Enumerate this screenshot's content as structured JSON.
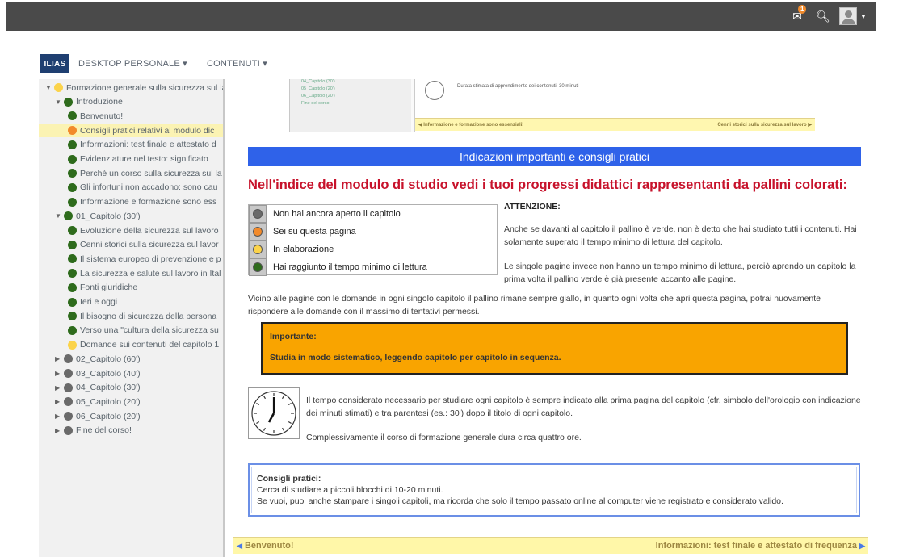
{
  "header": {
    "notification_count": "1"
  },
  "nav": {
    "logo": "ILIAS",
    "desktop": "DESKTOP PERSONALE ▾",
    "contenuti": "CONTENUTI ▾"
  },
  "tree": {
    "items": [
      {
        "label": "Formazione generale sulla sicurezza sul lav",
        "dot": "yellow",
        "arrow": "▼"
      },
      {
        "label": "Introduzione",
        "dot": "green",
        "arrow": "▼"
      },
      {
        "label": "Benvenuto!",
        "dot": "green"
      },
      {
        "label": "Consigli pratici relativi al modulo dic",
        "dot": "orange"
      },
      {
        "label": "Informazioni: test finale e attestato d",
        "dot": "green"
      },
      {
        "label": "Evidenziature nel testo: significato",
        "dot": "green"
      },
      {
        "label": "Perchè un corso sulla sicurezza sul la",
        "dot": "green"
      },
      {
        "label": "Gli infortuni non accadono: sono cau",
        "dot": "green"
      },
      {
        "label": "Informazione e formazione sono ess",
        "dot": "green"
      },
      {
        "label": "01_Capitolo (30')",
        "dot": "green",
        "arrow": "▼"
      },
      {
        "label": "Evoluzione della sicurezza sul lavoro",
        "dot": "green"
      },
      {
        "label": "Cenni storici sulla sicurezza sul lavor",
        "dot": "green"
      },
      {
        "label": "Il sistema europeo di prevenzione e p",
        "dot": "green"
      },
      {
        "label": "La sicurezza e salute sul lavoro in Ital",
        "dot": "green"
      },
      {
        "label": "Fonti giuridiche",
        "dot": "green"
      },
      {
        "label": "Ieri e oggi",
        "dot": "green"
      },
      {
        "label": "Il bisogno di sicurezza della persona",
        "dot": "green"
      },
      {
        "label": "Verso una \"cultura della sicurezza su",
        "dot": "green"
      },
      {
        "label": "Domande sui contenuti del capitolo 1",
        "dot": "yellow"
      },
      {
        "label": "02_Capitolo (60')",
        "dot": "grey",
        "arrow": "▶"
      },
      {
        "label": "03_Capitolo (40')",
        "dot": "grey",
        "arrow": "▶"
      },
      {
        "label": "04_Capitolo (30')",
        "dot": "grey",
        "arrow": "▶"
      },
      {
        "label": "05_Capitolo (20')",
        "dot": "grey",
        "arrow": "▶"
      },
      {
        "label": "06_Capitolo (20')",
        "dot": "grey",
        "arrow": "▶"
      },
      {
        "label": "Fine del corso!",
        "dot": "grey",
        "arrow": "▶"
      }
    ]
  },
  "thumb": {
    "items": [
      "04_Capitolo (30')",
      "05_Capitolo (20')",
      "06_Capitolo (20')",
      "Fine del corso!"
    ],
    "duration": "Durata stimata di apprendimento dei contenuti: 30 minuti",
    "prev": "◀ Informazione e formazione sono essenziali!",
    "next": "Cenni storici sulla sicurezza sul lavoro ▶"
  },
  "content": {
    "section_title": "Indicazioni importanti e consigli pratici",
    "red_title": "Nell'indice del modulo di studio vedi i tuoi progressi didattici rappresentanti da pallini colorati:",
    "legend": [
      {
        "label": "Non hai ancora aperto il capitolo",
        "color": "#6a6a6a"
      },
      {
        "label": "Sei su questa pagina",
        "color": "#f28a2b"
      },
      {
        "label": "In elaborazione",
        "color": "#fbd34a"
      },
      {
        "label": "Hai raggiunto il tempo minimo di lettura",
        "color": "#2e6b1c"
      }
    ],
    "attention_title": "ATTENZIONE:",
    "attention_p1": "Anche se davanti al capitolo il pallino è verde, non è detto che hai studiato tutti i contenuti. Hai solamente superato il tempo minimo di lettura del capitolo.",
    "attention_p2": "Le singole pagine invece non hanno un tempo minimo di lettura, perciò aprendo un capitolo la prima volta il pallino verde è già presente accanto alle pagine.",
    "questions_para": "Vicino alle pagine con le domande in ogni singolo capitolo il pallino rimane sempre giallo, in quanto ogni volta che apri questa pagina, potrai nuovamente rispondere alle domande con il massimo di tentativi permessi.",
    "important_title": "Importante:",
    "important_text": "Studia in modo sistematico, leggendo capitolo per capitolo in sequenza.",
    "time_p1": "Il tempo considerato necessario per studiare ogni capitolo è sempre indicato alla prima pagina del capitolo (cfr. simbolo dell'orologio con indicazione dei minuti stimati) e tra parentesi (es.: 30') dopo il titolo di ogni capitolo.",
    "time_p2": "Complessivamente il corso di formazione generale dura circa quattro ore.",
    "tips_title": "Consigli pratici:",
    "tips_l1": "Cerca di studiare a piccoli blocchi di 10-20 minuti.",
    "tips_l2": "Se vuoi, puoi anche stampare i singoli capitoli, ma ricorda che solo il tempo passato online al computer viene registrato e considerato valido."
  },
  "bottom": {
    "prev": "Benvenuto!",
    "next": "Informazioni: test finale e attestato di frequenza"
  },
  "colors": {
    "accent_blue": "#2f62e9",
    "title_red": "#c7122b",
    "important_orange": "#f9a400",
    "nav_yellow": "#fff7a8"
  }
}
